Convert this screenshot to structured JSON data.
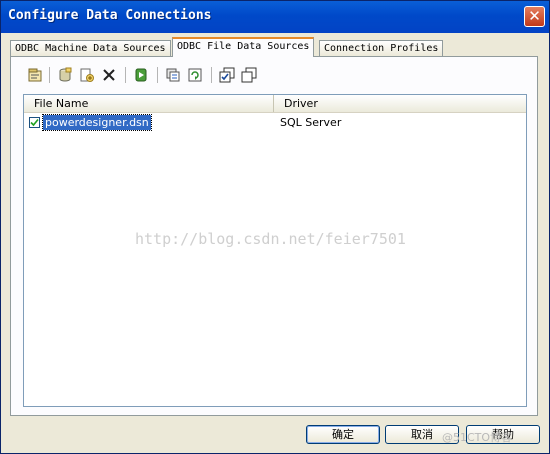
{
  "window": {
    "title": "Configure Data Connections",
    "close_label": "✕"
  },
  "tabs": [
    {
      "label": "ODBC Machine Data Sources"
    },
    {
      "label": "ODBC File Data Sources"
    },
    {
      "label": "Connection Profiles"
    }
  ],
  "toolbar": {
    "icons": [
      "properties-icon",
      "database-icon",
      "new-dsn-icon",
      "delete-icon",
      "run-icon",
      "compare-icon",
      "refresh-icon",
      "check-all-icon",
      "uncheck-all-icon"
    ]
  },
  "list": {
    "columns": [
      "File Name",
      "Driver"
    ],
    "rows": [
      {
        "file_name": "powerdesigner.dsn",
        "driver": "SQL Server",
        "checked": true
      }
    ]
  },
  "watermark": "http://blog.csdn.net/feier7501",
  "buttons": {
    "ok": "确定",
    "cancel": "取消",
    "help": "帮助"
  },
  "corner_watermark": "@51CTO博客",
  "colors": {
    "titlebar": "#0054e3",
    "active_tab_accent": "#e68b2c",
    "selection": "#316ac5"
  }
}
